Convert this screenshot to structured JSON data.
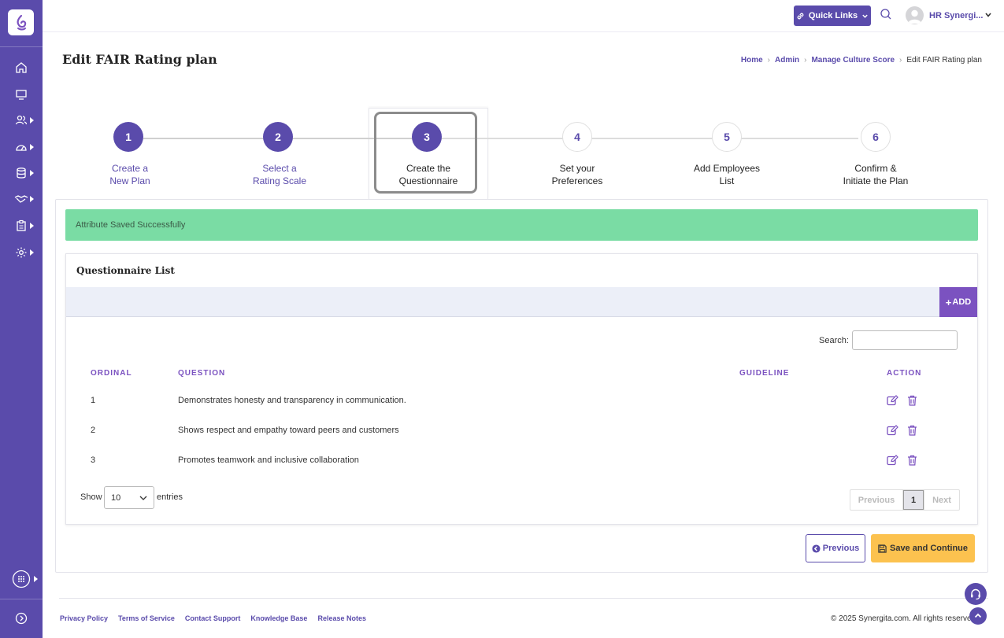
{
  "header": {
    "quick_links_label": "Quick Links",
    "user_name": "HR Synergi..."
  },
  "page": {
    "title": "Edit FAIR Rating plan"
  },
  "breadcrumb": {
    "items": [
      "Home",
      "Admin",
      "Manage Culture Score"
    ],
    "current": "Edit FAIR Rating plan",
    "separator": "›"
  },
  "stepper": {
    "steps": [
      {
        "number": "1",
        "line1": "Create a",
        "line2": "New Plan",
        "state": "done"
      },
      {
        "number": "2",
        "line1": "Select a",
        "line2": "Rating Scale",
        "state": "done"
      },
      {
        "number": "3",
        "line1": "Create the",
        "line2": "Questionnaire",
        "state": "active"
      },
      {
        "number": "4",
        "line1": "Set your",
        "line2": "Preferences",
        "state": "todo"
      },
      {
        "number": "5",
        "line1": "Add Employees",
        "line2": "List",
        "state": "todo"
      },
      {
        "number": "6",
        "line1": "Confirm &",
        "line2": "Initiate the Plan",
        "state": "todo"
      }
    ]
  },
  "alert": {
    "message": "Attribute Saved Successfully"
  },
  "questionnaire": {
    "title": "Questionnaire List",
    "add_label": "ADD",
    "search_label": "Search:",
    "search_value": "",
    "columns": [
      "ORDINAL",
      "QUESTION",
      "GUIDELINE",
      "ACTION"
    ],
    "rows": [
      {
        "ordinal": "1",
        "question": "Demonstrates honesty and transparency in communication.",
        "guideline": ""
      },
      {
        "ordinal": "2",
        "question": "Shows respect and empathy toward peers and customers",
        "guideline": ""
      },
      {
        "ordinal": "3",
        "question": "Promotes teamwork and inclusive collaboration",
        "guideline": ""
      }
    ],
    "show_label": "Show",
    "entries_value": "10",
    "entries_label": "entries",
    "pager": {
      "previous": "Previous",
      "page": "1",
      "next": "Next"
    }
  },
  "actions": {
    "previous_label": "Previous",
    "save_label": "Save and Continue"
  },
  "footer": {
    "links": [
      "Privacy Policy",
      "Terms of Service",
      "Contact Support",
      "Knowledge Base",
      "Release Notes"
    ],
    "copyright": "© 2025 Synergita.com. All rights reserved."
  },
  "colors": {
    "brand": "#5a4bab",
    "accent": "#7b52c0",
    "success": "#7adca4",
    "save": "#fcc24f"
  }
}
